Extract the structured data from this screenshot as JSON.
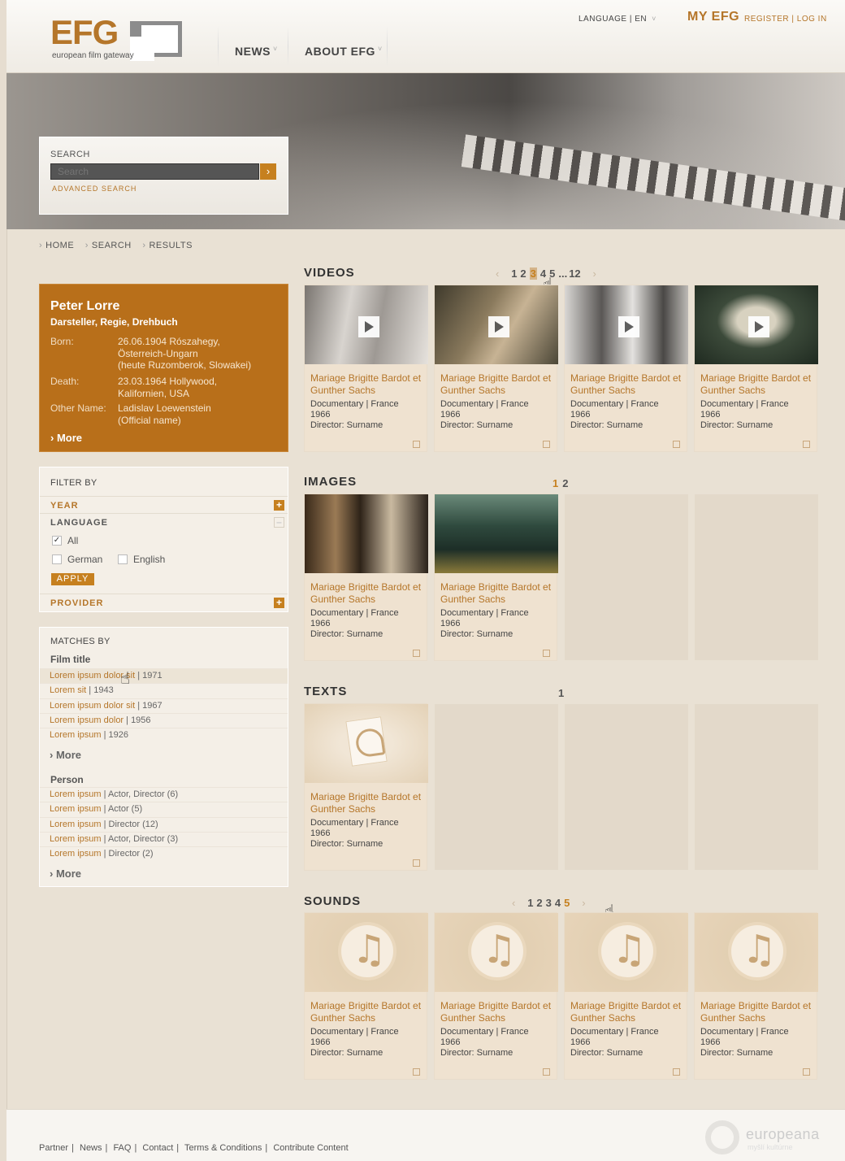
{
  "header": {
    "logo": "EFG",
    "logo_sub": "european film gateway",
    "nav": [
      "NEWS",
      "ABOUT EFG"
    ],
    "language": "LANGUAGE | EN",
    "myefg": "MY EFG",
    "register_login": "REGISTER | LOG IN"
  },
  "search": {
    "label": "SEARCH",
    "placeholder": "Search",
    "advanced": "ADVANCED SEARCH"
  },
  "breadcrumb": [
    "HOME",
    "SEARCH",
    "RESULTS"
  ],
  "person": {
    "name": "Peter Lorre",
    "roles": "Darsteller, Regie, Drehbuch",
    "born_label": "Born:",
    "born": "26.06.1904 Rószahegy,\nÖsterreich-Ungarn\n(heute Ruzomberok, Slowakei)",
    "death_label": "Death:",
    "death": "23.03.1964 Hollywood,\nKalifornien, USA",
    "other_label": "Other Name:",
    "other": "Ladislav Loewenstein\n(Official name)",
    "more": "More"
  },
  "filter": {
    "title": "FILTER BY",
    "year": "YEAR",
    "language": "LANGUAGE",
    "options": [
      "All",
      "German",
      "English"
    ],
    "apply": "APPLY",
    "provider": "PROVIDER"
  },
  "matches": {
    "title": "MATCHES BY",
    "film_head": "Film title",
    "films": [
      {
        "link": "Lorem ipsum dolor sit",
        "rest": " | 1971"
      },
      {
        "link": "Lorem sit",
        "rest": " | 1943"
      },
      {
        "link": "Lorem ipsum dolor sit",
        "rest": " | 1967"
      },
      {
        "link": "Lorem ipsum dolor",
        "rest": " | 1956"
      },
      {
        "link": "Lorem ipsum",
        "rest": " | 1926"
      }
    ],
    "more1": "More",
    "person_head": "Person",
    "persons": [
      {
        "link": "Lorem ipsum",
        "rest": " | Actor, Director (6)"
      },
      {
        "link": "Lorem ipsum",
        "rest": " | Actor (5)"
      },
      {
        "link": "Lorem ipsum",
        "rest": " | Director (12)"
      },
      {
        "link": "Lorem ipsum",
        "rest": " | Actor, Director (3)"
      },
      {
        "link": "Lorem ipsum",
        "rest": " | Director (2)"
      }
    ],
    "more2": "More"
  },
  "card": {
    "title": "Mariage Brigitte Bardot et Gunther Sachs",
    "meta1": "Documentary | France",
    "meta2": "1966",
    "meta3": "Director: Surname"
  },
  "sections": {
    "videos": {
      "title": "VIDEOS",
      "pages": [
        "1",
        "2",
        "3",
        "4",
        "5",
        "...",
        "12"
      ]
    },
    "images": {
      "title": "IMAGES",
      "pages": [
        "1",
        "2"
      ]
    },
    "texts": {
      "title": "TEXTS",
      "pages": [
        "1"
      ]
    },
    "sounds": {
      "title": "SOUNDS",
      "pages": [
        "1",
        "2",
        "3",
        "4",
        "5"
      ]
    }
  },
  "footer": {
    "links": [
      "Partner",
      "News",
      "FAQ",
      "Contact",
      "Terms & Conditions",
      "Contribute Content"
    ],
    "europeana": "europeana",
    "europeana_sub": "myšlí kultúrne"
  }
}
